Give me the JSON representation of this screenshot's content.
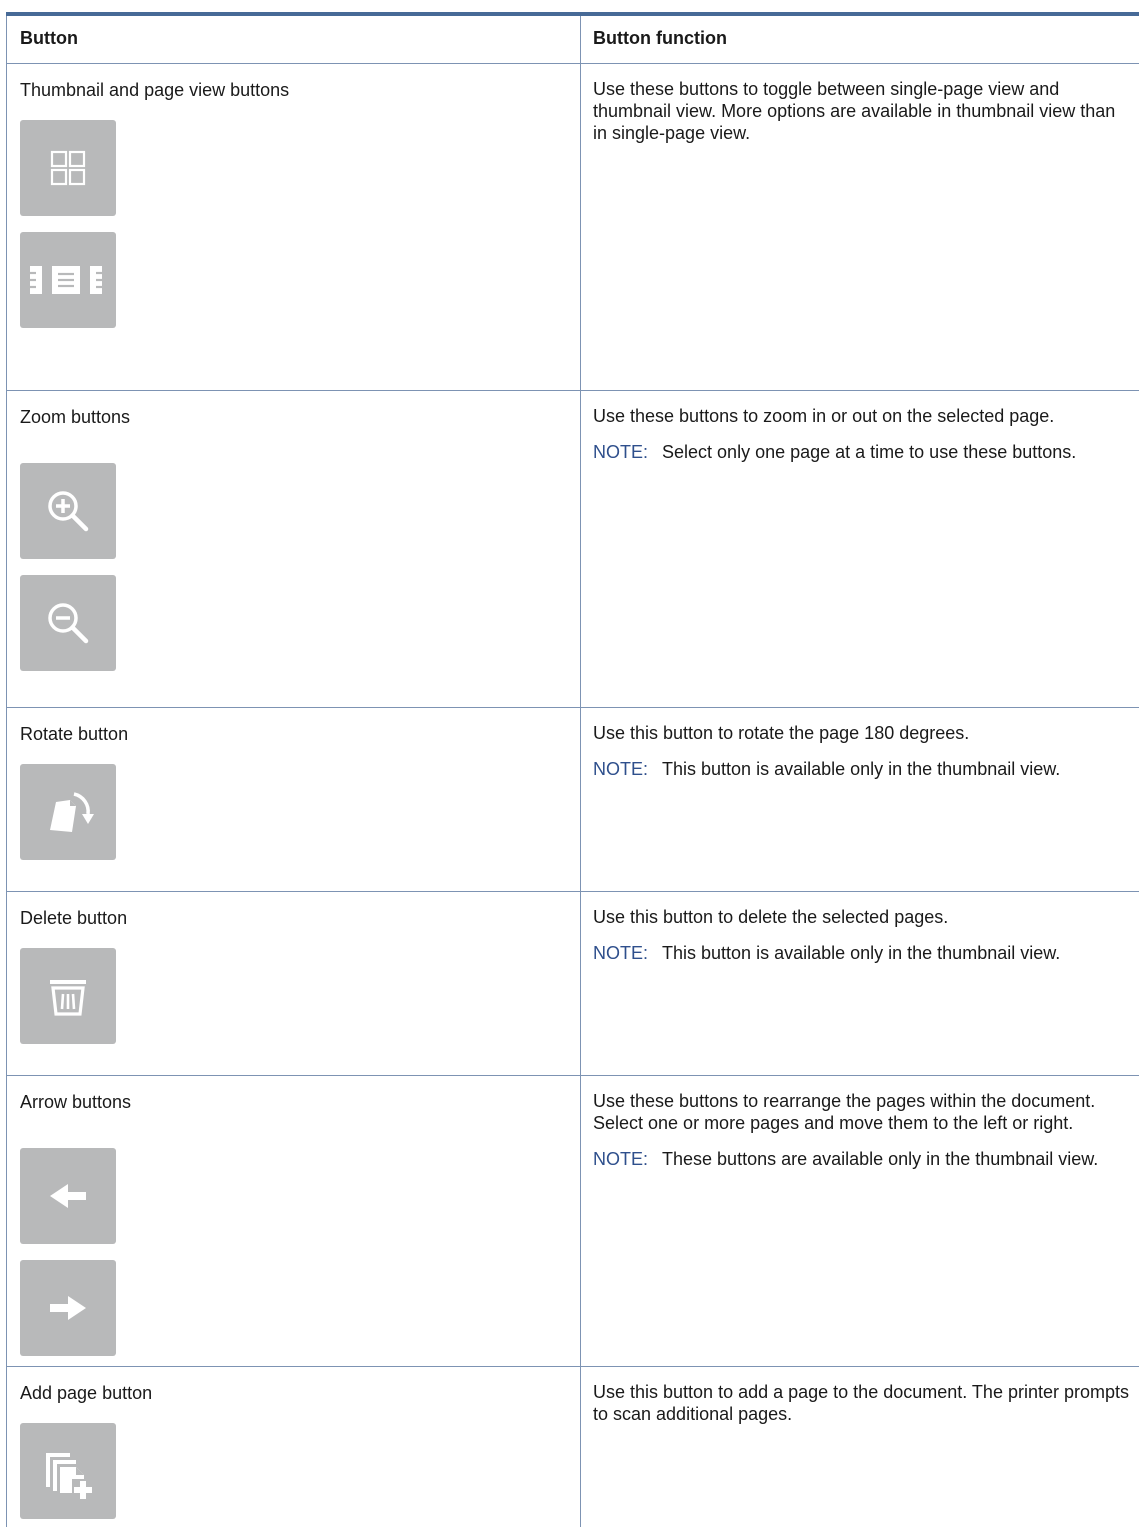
{
  "table": {
    "header": {
      "col1": "Button",
      "col2": "Button function"
    },
    "rows": [
      {
        "name": "Thumbnail and page view buttons",
        "description": "Use these buttons to toggle between single-page view and thumbnail view. More options are available in thumbnail view than in single-page view.",
        "note": null,
        "icons": [
          "thumbnail-view-icon",
          "page-view-icon"
        ]
      },
      {
        "name": "Zoom buttons",
        "description": "Use these buttons to zoom in or out on the selected page.",
        "note": "Select only one page at a time to use these buttons.",
        "icons": [
          "zoom-in-icon",
          "zoom-out-icon"
        ]
      },
      {
        "name": "Rotate button",
        "description": "Use this button to rotate the page 180 degrees.",
        "note": "This button is available only in the thumbnail view.",
        "icons": [
          "rotate-icon"
        ]
      },
      {
        "name": "Delete button",
        "description": "Use this button to delete the selected pages.",
        "note": "This button is available only in the thumbnail view.",
        "icons": [
          "trash-icon"
        ]
      },
      {
        "name": "Arrow buttons",
        "description": "Use these buttons to rearrange the pages within the document. Select one or more pages and move them to the left or right.",
        "note": "These buttons are available only in the thumbnail view.",
        "icons": [
          "arrow-left-icon",
          "arrow-right-icon"
        ]
      },
      {
        "name": "Add page button",
        "description": "Use this button to add a page to the document. The printer prompts to scan additional pages.",
        "note": null,
        "icons": [
          "add-page-icon"
        ]
      }
    ],
    "note_label": "NOTE:"
  },
  "colors": {
    "rule": "#476a97",
    "border": "#7d93b3",
    "note_label": "#2e4f8c",
    "icon_bg": "#b8b9ba",
    "icon_fg": "#ffffff"
  }
}
